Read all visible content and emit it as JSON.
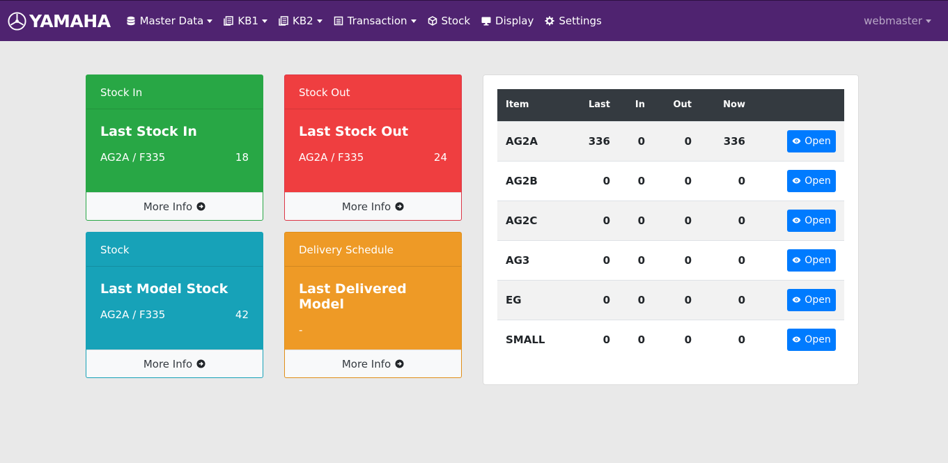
{
  "navbar": {
    "brand": "YAMAHA",
    "items": [
      {
        "label": "Master Data",
        "icon": "database-icon",
        "dropdown": true
      },
      {
        "label": "KB1",
        "icon": "copy-icon",
        "dropdown": true
      },
      {
        "label": "KB2",
        "icon": "copy-icon",
        "dropdown": true
      },
      {
        "label": "Transaction",
        "icon": "list-icon",
        "dropdown": true
      },
      {
        "label": "Stock",
        "icon": "cube-icon",
        "dropdown": false
      },
      {
        "label": "Display",
        "icon": "desktop-icon",
        "dropdown": false
      },
      {
        "label": "Settings",
        "icon": "gear-icon",
        "dropdown": false
      }
    ],
    "user": "webmaster"
  },
  "cards": {
    "stock_in": {
      "header": "Stock In",
      "title": "Last Stock In",
      "model": "AG2A / F335",
      "qty": "18",
      "footer": "More Info"
    },
    "stock_out": {
      "header": "Stock Out",
      "title": "Last Stock Out",
      "model": "AG2A / F335",
      "qty": "24",
      "footer": "More Info"
    },
    "stock": {
      "header": "Stock",
      "title": "Last Model Stock",
      "model": "AG2A / F335",
      "qty": "42",
      "footer": "More Info"
    },
    "delivery": {
      "header": "Delivery Schedule",
      "title": "Last Delivered Model",
      "model": "-",
      "qty": "",
      "footer": "More Info"
    }
  },
  "colors": {
    "navbar": "#4f2370",
    "green": "#28a745",
    "red": "#ef3e40",
    "teal": "#17a2b8",
    "orange": "#ee9a26",
    "button": "#007bff"
  },
  "table": {
    "headers": [
      "Item",
      "Last",
      "In",
      "Out",
      "Now"
    ],
    "button_label": "Open",
    "rows": [
      {
        "item": "AG2A",
        "last": "336",
        "in": "0",
        "out": "0",
        "now": "336"
      },
      {
        "item": "AG2B",
        "last": "0",
        "in": "0",
        "out": "0",
        "now": "0"
      },
      {
        "item": "AG2C",
        "last": "0",
        "in": "0",
        "out": "0",
        "now": "0"
      },
      {
        "item": "AG3",
        "last": "0",
        "in": "0",
        "out": "0",
        "now": "0"
      },
      {
        "item": "EG",
        "last": "0",
        "in": "0",
        "out": "0",
        "now": "0"
      },
      {
        "item": "SMALL",
        "last": "0",
        "in": "0",
        "out": "0",
        "now": "0"
      }
    ]
  }
}
